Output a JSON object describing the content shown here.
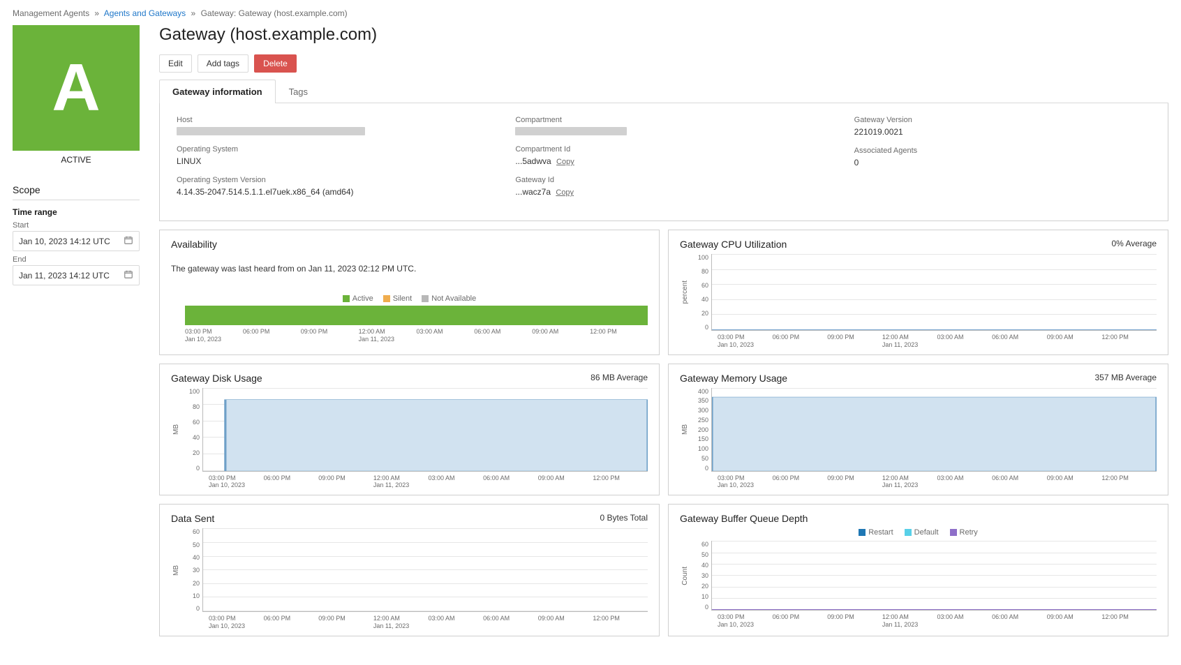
{
  "breadcrumb": {
    "root": "Management Agents",
    "link": "Agents and Gateways",
    "current": "Gateway: Gateway (host.example.com)"
  },
  "page_title": "Gateway (host.example.com)",
  "status": {
    "letter": "A",
    "label": "ACTIVE"
  },
  "actions": {
    "edit": "Edit",
    "add_tags": "Add tags",
    "delete": "Delete"
  },
  "tabs": {
    "info": "Gateway information",
    "tags": "Tags"
  },
  "info": {
    "host_label": "Host",
    "os_label": "Operating System",
    "os_value": "LINUX",
    "osver_label": "Operating System Version",
    "osver_value": "4.14.35-2047.514.5.1.1.el7uek.x86_64 (amd64)",
    "compartment_label": "Compartment",
    "compid_label": "Compartment Id",
    "compid_value": "...5adwva",
    "copy": "Copy",
    "gwid_label": "Gateway Id",
    "gwid_value": "...wacz7a",
    "gwver_label": "Gateway Version",
    "gwver_value": "221019.0021",
    "assoc_label": "Associated Agents",
    "assoc_value": "0"
  },
  "scope": {
    "heading": "Scope",
    "time_range": "Time range",
    "start": "Start",
    "end": "End",
    "start_value": "Jan 10, 2023 14:12 UTC",
    "end_value": "Jan 11, 2023 14:12 UTC"
  },
  "availability": {
    "title": "Availability",
    "text": "The gateway was last heard from on Jan 11, 2023 02:12 PM UTC.",
    "legend_active": "Active",
    "legend_silent": "Silent",
    "legend_na": "Not Available"
  },
  "cpu": {
    "title": "Gateway CPU Utilization",
    "summary": "0% Average",
    "ylabel": "percent"
  },
  "disk": {
    "title": "Gateway Disk Usage",
    "summary": "86 MB Average",
    "ylabel": "MB"
  },
  "mem": {
    "title": "Gateway Memory Usage",
    "summary": "357 MB Average",
    "ylabel": "MB"
  },
  "sent": {
    "title": "Data Sent",
    "summary": "0 Bytes Total",
    "ylabel": "MB"
  },
  "queue": {
    "title": "Gateway Buffer Queue Depth",
    "ylabel": "Count",
    "legend_restart": "Restart",
    "legend_default": "Default",
    "legend_retry": "Retry"
  },
  "xaxis": {
    "ticks": [
      {
        "t": "03:00 PM",
        "d": "Jan 10, 2023"
      },
      {
        "t": "06:00 PM",
        "d": ""
      },
      {
        "t": "09:00 PM",
        "d": ""
      },
      {
        "t": "12:00 AM",
        "d": "Jan 11, 2023"
      },
      {
        "t": "03:00 AM",
        "d": ""
      },
      {
        "t": "06:00 AM",
        "d": ""
      },
      {
        "t": "09:00 AM",
        "d": ""
      },
      {
        "t": "12:00 PM",
        "d": ""
      }
    ]
  },
  "chart_data": [
    {
      "type": "bar",
      "title": "Availability",
      "categories": [
        "03:00 PM",
        "06:00 PM",
        "09:00 PM",
        "12:00 AM",
        "03:00 AM",
        "06:00 AM",
        "09:00 AM",
        "12:00 PM"
      ],
      "series": [
        {
          "name": "Active",
          "values": [
            1,
            1,
            1,
            1,
            1,
            1,
            1,
            1
          ]
        },
        {
          "name": "Silent",
          "values": [
            0,
            0,
            0,
            0,
            0,
            0,
            0,
            0
          ]
        },
        {
          "name": "Not Available",
          "values": [
            0,
            0,
            0,
            0,
            0,
            0,
            0,
            0
          ]
        }
      ],
      "xlabel": "",
      "ylabel": "",
      "ylim": [
        0,
        1
      ]
    },
    {
      "type": "line",
      "title": "Gateway CPU Utilization",
      "x": [
        "03:00 PM",
        "06:00 PM",
        "09:00 PM",
        "12:00 AM",
        "03:00 AM",
        "06:00 AM",
        "09:00 AM",
        "12:00 PM"
      ],
      "series": [
        {
          "name": "percent",
          "values": [
            0,
            0,
            0,
            0,
            0,
            0,
            0,
            0
          ]
        }
      ],
      "xlabel": "",
      "ylabel": "percent",
      "ylim": [
        0,
        100
      ]
    },
    {
      "type": "area",
      "title": "Gateway Disk Usage",
      "x": [
        "03:00 PM",
        "06:00 PM",
        "09:00 PM",
        "12:00 AM",
        "03:00 AM",
        "06:00 AM",
        "09:00 AM",
        "12:00 PM"
      ],
      "series": [
        {
          "name": "MB",
          "values": [
            86,
            86,
            86,
            86,
            86,
            86,
            86,
            86
          ]
        }
      ],
      "xlabel": "",
      "ylabel": "MB",
      "ylim": [
        0,
        100
      ]
    },
    {
      "type": "area",
      "title": "Gateway Memory Usage",
      "x": [
        "03:00 PM",
        "06:00 PM",
        "09:00 PM",
        "12:00 AM",
        "03:00 AM",
        "06:00 AM",
        "09:00 AM",
        "12:00 PM"
      ],
      "series": [
        {
          "name": "MB",
          "values": [
            357,
            357,
            357,
            357,
            357,
            357,
            357,
            357
          ]
        }
      ],
      "xlabel": "",
      "ylabel": "MB",
      "ylim": [
        0,
        400
      ]
    },
    {
      "type": "line",
      "title": "Data Sent",
      "x": [
        "03:00 PM",
        "06:00 PM",
        "09:00 PM",
        "12:00 AM",
        "03:00 AM",
        "06:00 AM",
        "09:00 AM",
        "12:00 PM"
      ],
      "series": [
        {
          "name": "MB",
          "values": [
            0,
            0,
            0,
            0,
            0,
            0,
            0,
            0
          ]
        }
      ],
      "xlabel": "",
      "ylabel": "MB",
      "ylim": [
        0,
        60
      ]
    },
    {
      "type": "line",
      "title": "Gateway Buffer Queue Depth",
      "x": [
        "03:00 PM",
        "06:00 PM",
        "09:00 PM",
        "12:00 AM",
        "03:00 AM",
        "06:00 AM",
        "09:00 AM",
        "12:00 PM"
      ],
      "series": [
        {
          "name": "Restart",
          "values": [
            0,
            0,
            0,
            0,
            0,
            0,
            0,
            0
          ]
        },
        {
          "name": "Default",
          "values": [
            0,
            0,
            0,
            0,
            0,
            0,
            0,
            0
          ]
        },
        {
          "name": "Retry",
          "values": [
            0,
            0,
            0,
            0,
            0,
            0,
            0,
            0
          ]
        }
      ],
      "xlabel": "",
      "ylabel": "Count",
      "ylim": [
        0,
        60
      ]
    }
  ],
  "yticks": {
    "cpu": [
      "100",
      "80",
      "60",
      "40",
      "20",
      "0"
    ],
    "disk": [
      "100",
      "80",
      "60",
      "40",
      "20",
      "0"
    ],
    "mem": [
      "400",
      "350",
      "300",
      "250",
      "200",
      "150",
      "100",
      "50",
      "0"
    ],
    "sent": [
      "60",
      "50",
      "40",
      "30",
      "20",
      "10",
      "0"
    ],
    "queue": [
      "60",
      "50",
      "40",
      "30",
      "20",
      "10",
      "0"
    ]
  }
}
